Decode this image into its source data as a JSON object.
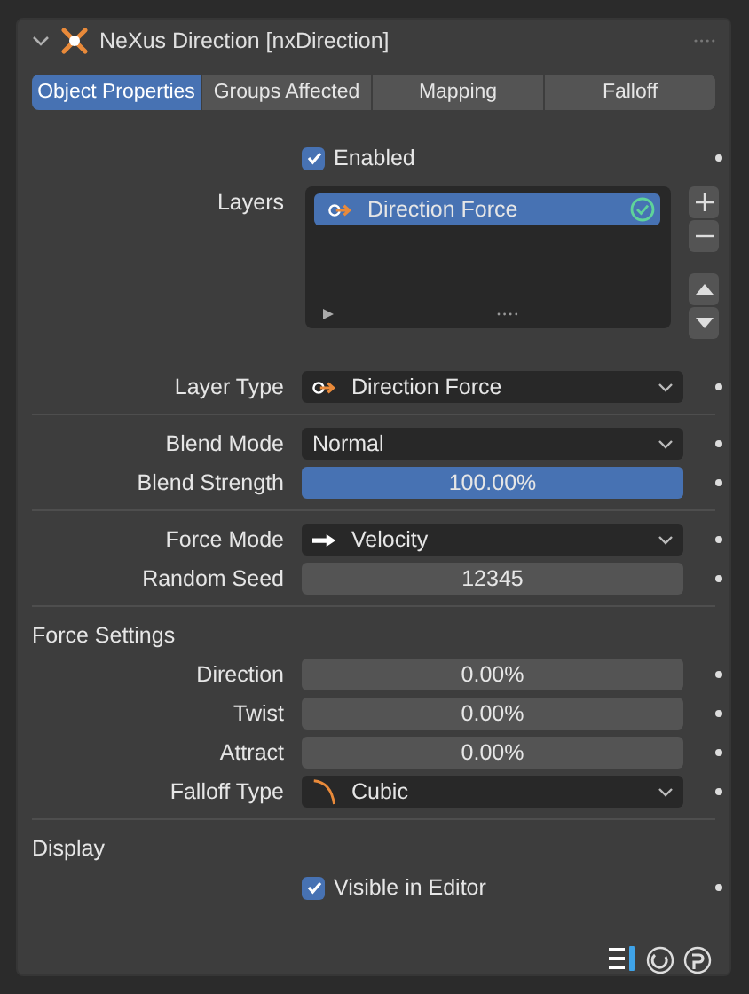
{
  "panel": {
    "title": "NeXus Direction [nxDirection]",
    "expanded": true
  },
  "tabs": [
    {
      "label": "Object Properties",
      "selected": true
    },
    {
      "label": "Groups Affected",
      "selected": false
    },
    {
      "label": "Mapping",
      "selected": false
    },
    {
      "label": "Falloff",
      "selected": false
    }
  ],
  "enabled": {
    "label": "Enabled",
    "checked": true
  },
  "layers": {
    "label": "Layers",
    "items": [
      {
        "name": "Direction Force",
        "selected": true,
        "active": true
      }
    ]
  },
  "groups": [
    {
      "rows": [
        {
          "kind": "dropdown",
          "label": "Layer Type",
          "value": "Direction Force"
        }
      ]
    },
    {
      "rows": [
        {
          "kind": "dropdown",
          "label": "Blend Mode",
          "value": "Normal"
        },
        {
          "kind": "slider",
          "label": "Blend Strength",
          "value": "100.00%",
          "level": 1
        }
      ]
    },
    {
      "rows": [
        {
          "kind": "dropdown",
          "label": "Force Mode",
          "value": "Velocity"
        },
        {
          "kind": "number",
          "label": "Random Seed",
          "value": "12345"
        }
      ]
    },
    {
      "heading": "Force Settings",
      "rows": [
        {
          "kind": "slider",
          "label": "Direction",
          "value": "0.00%"
        },
        {
          "kind": "slider",
          "label": "Twist",
          "value": "0.00%"
        },
        {
          "kind": "slider",
          "label": "Attract",
          "value": "0.00%"
        },
        {
          "kind": "dropdown",
          "label": "Falloff Type",
          "value": "Cubic"
        }
      ]
    },
    {
      "heading": "Display",
      "rows": [
        {
          "kind": "checkbox",
          "label": "Visible in Editor",
          "checked": true
        }
      ]
    }
  ]
}
